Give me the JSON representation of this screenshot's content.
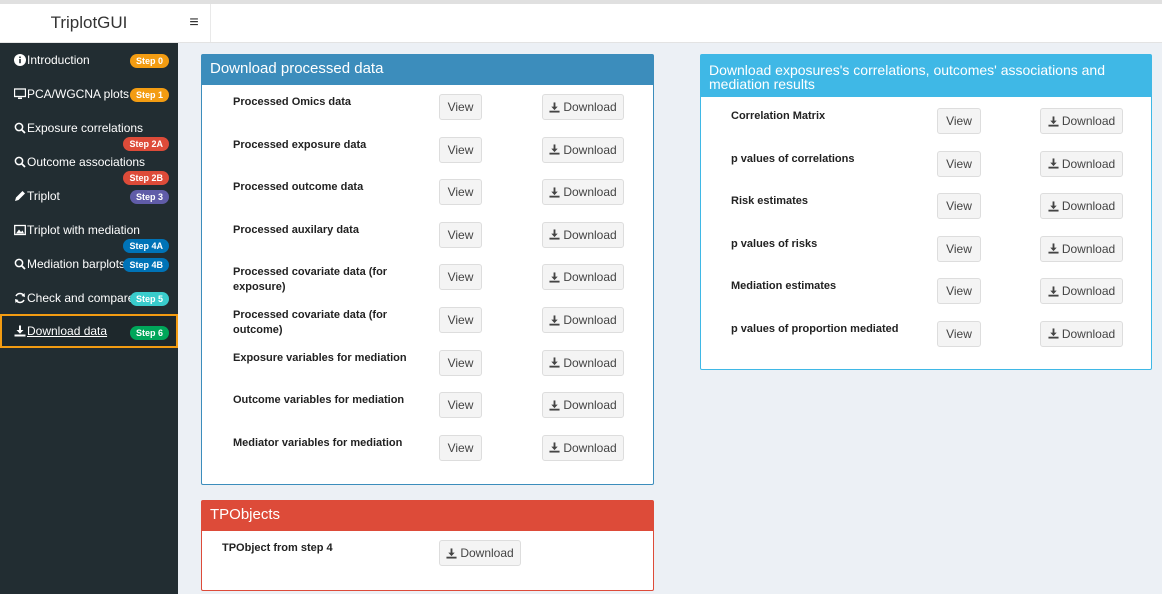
{
  "app": {
    "title": "TriplotGUI",
    "toggle_icon": "≡"
  },
  "sidebar": {
    "items": [
      {
        "label": "Introduction",
        "icon": "info-icon",
        "badge": "Step 0",
        "badge_color": "#f39c12"
      },
      {
        "label": "PCA/WGCNA plots",
        "icon": "desktop-icon",
        "badge": "Step 1",
        "badge_color": "#f39c12"
      },
      {
        "label": "Exposure correlations",
        "icon": "search-icon",
        "badge": "Step 2A",
        "badge_color": "#dd4b39"
      },
      {
        "label": "Outcome associations",
        "icon": "search-icon",
        "badge": "Step 2B",
        "badge_color": "#dd4b39"
      },
      {
        "label": "Triplot",
        "icon": "pencil-icon",
        "badge": "Step 3",
        "badge_color": "#605ca8"
      },
      {
        "label": "Triplot with mediation",
        "icon": "image-icon",
        "badge": "Step 4A",
        "badge_color": "#0073b7"
      },
      {
        "label": "Mediation barplots",
        "icon": "search-icon",
        "badge": "Step 4B",
        "badge_color": "#0073b7"
      },
      {
        "label": "Check and compare",
        "icon": "refresh-icon",
        "badge": "Step 5",
        "badge_color": "#39cccc"
      },
      {
        "label": "Download data",
        "icon": "download-icon",
        "badge": "Step 6",
        "badge_color": "#00a65a"
      }
    ]
  },
  "processed": {
    "title": "Download processed data",
    "view_label": "View",
    "download_label": "Download",
    "rows": [
      {
        "label1": "Processed Omics data",
        "label2": ""
      },
      {
        "label1": "Processed exposure data",
        "label2": ""
      },
      {
        "label1": "Processed outcome data",
        "label2": ""
      },
      {
        "label1": "Processed auxilary data",
        "label2": ""
      },
      {
        "label1": "Processed covariate data (for",
        "label2": "exposure)"
      },
      {
        "label1": "Processed covariate data (for",
        "label2": "outcome)"
      },
      {
        "label1": "Exposure variables for mediation",
        "label2": ""
      },
      {
        "label1": "Outcome variables for mediation",
        "label2": ""
      },
      {
        "label1": "Mediator variables for mediation",
        "label2": ""
      }
    ]
  },
  "results": {
    "title1": "Download exposures's correlations, outcomes' associations and",
    "title2": "mediation results",
    "view_label": "View",
    "download_label": "Download",
    "rows": [
      "Correlation Matrix",
      "p values of correlations",
      "Risk estimates",
      "p values of risks",
      "Mediation estimates",
      "p values of proportion mediated"
    ]
  },
  "tpobjects": {
    "title": "TPObjects",
    "row_label": "TPObject from step 4",
    "download_label": "Download"
  },
  "colors": {
    "primary": "#3c8dbc",
    "info": "#3fb8e6",
    "danger": "#dd4b39",
    "sidebar_bg": "#222d32"
  }
}
